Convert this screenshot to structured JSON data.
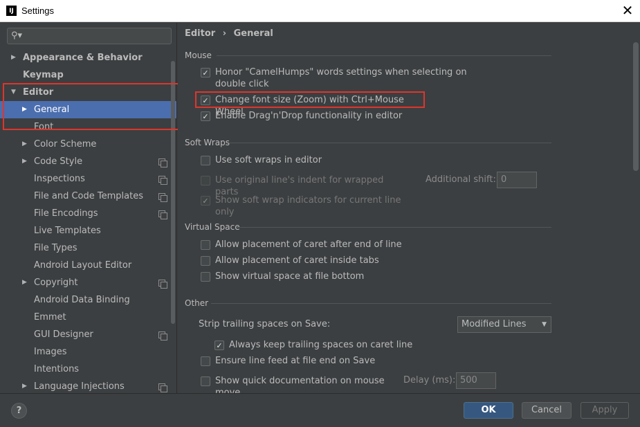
{
  "window": {
    "title": "Settings",
    "app_icon_text": "IJ"
  },
  "search": {
    "placeholder": ""
  },
  "sidebar": {
    "items": [
      {
        "label": "Appearance & Behavior"
      },
      {
        "label": "Keymap"
      },
      {
        "label": "Editor"
      },
      {
        "label": "General"
      },
      {
        "label": "Font"
      },
      {
        "label": "Color Scheme"
      },
      {
        "label": "Code Style"
      },
      {
        "label": "Inspections"
      },
      {
        "label": "File and Code Templates"
      },
      {
        "label": "File Encodings"
      },
      {
        "label": "Live Templates"
      },
      {
        "label": "File Types"
      },
      {
        "label": "Android Layout Editor"
      },
      {
        "label": "Copyright"
      },
      {
        "label": "Android Data Binding"
      },
      {
        "label": "Emmet"
      },
      {
        "label": "GUI Designer"
      },
      {
        "label": "Images"
      },
      {
        "label": "Intentions"
      },
      {
        "label": "Language Injections"
      }
    ]
  },
  "breadcrumb": {
    "parent": "Editor",
    "separator": "›",
    "current": "General"
  },
  "sections": {
    "mouse": {
      "title": "Mouse",
      "honor_camelhumps_line1": "Honor \"CamelHumps\" words settings when selecting on",
      "honor_camelhumps_line2": "double click",
      "change_font_size": "Change font size (Zoom) with Ctrl+Mouse Wheel",
      "drag_drop": "Enable Drag'n'Drop functionality in editor"
    },
    "soft_wraps": {
      "title": "Soft Wraps",
      "use_soft_wraps": "Use soft wraps in editor",
      "use_original_indent": "Use original line's indent for wrapped parts",
      "additional_shift_label": "Additional shift:",
      "additional_shift_value": "0",
      "show_indicators": "Show soft wrap indicators for current line only"
    },
    "virtual_space": {
      "title": "Virtual Space",
      "after_end_of_line": "Allow placement of caret after end of line",
      "inside_tabs": "Allow placement of caret inside tabs",
      "at_file_bottom": "Show virtual space at file bottom"
    },
    "other": {
      "title": "Other",
      "strip_label": "Strip trailing spaces on Save:",
      "strip_value": "Modified Lines",
      "keep_trailing": "Always keep trailing spaces on caret line",
      "ensure_line_feed": "Ensure line feed at file end on Save",
      "quick_doc": "Show quick documentation on mouse move",
      "delay_label": "Delay (ms):",
      "delay_value": "500"
    }
  },
  "footer": {
    "help": "?",
    "ok": "OK",
    "cancel": "Cancel",
    "apply": "Apply"
  },
  "colors": {
    "selection": "#4b6eaf",
    "highlight_box": "#e0352b",
    "ok_button": "#365880"
  }
}
